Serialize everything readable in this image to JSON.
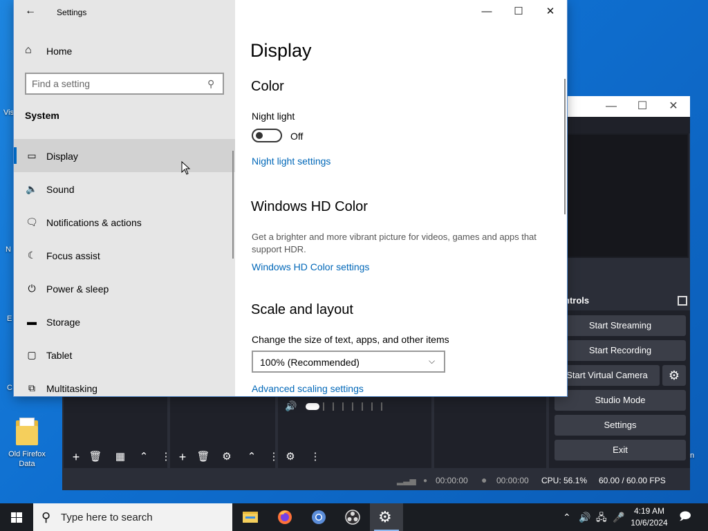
{
  "desktop": {
    "icon_label": "Old Firefox Data",
    "edge_fragments": [
      "Vis",
      "N",
      "E",
      "C"
    ],
    "right_fragment": "n"
  },
  "settings": {
    "title": "Settings",
    "home": "Home",
    "search_placeholder": "Find a setting",
    "section": "System",
    "nav": [
      {
        "label": "Display",
        "icon": "monitor-icon"
      },
      {
        "label": "Sound",
        "icon": "speaker-icon"
      },
      {
        "label": "Notifications & actions",
        "icon": "notification-icon"
      },
      {
        "label": "Focus assist",
        "icon": "moon-icon"
      },
      {
        "label": "Power & sleep",
        "icon": "power-icon"
      },
      {
        "label": "Storage",
        "icon": "storage-icon"
      },
      {
        "label": "Tablet",
        "icon": "tablet-icon"
      },
      {
        "label": "Multitasking",
        "icon": "multitasking-icon"
      }
    ],
    "main": {
      "title": "Display",
      "color_hdr": "Color",
      "night_light_label": "Night light",
      "night_light_state": "Off",
      "night_light_link": "Night light settings",
      "hdr_hdr": "Windows HD Color",
      "hdr_desc": "Get a brighter and more vibrant picture for videos, games and apps that support HDR.",
      "hdr_link": "Windows HD Color settings",
      "scale_hdr": "Scale and layout",
      "scale_label": "Change the size of text, apps, and other items",
      "scale_value": "100% (Recommended)",
      "advanced_link": "Advanced scaling settings"
    }
  },
  "obs": {
    "controls_title": "ntrols",
    "buttons": [
      "Start Streaming",
      "Start Recording",
      "Start Virtual Camera",
      "Studio Mode",
      "Settings",
      "Exit"
    ],
    "status": {
      "stream_time": "00:00:00",
      "rec_time": "00:00:00",
      "cpu": "CPU: 56.1%",
      "fps": "60.00 / 60.00 FPS"
    }
  },
  "taskbar": {
    "search_placeholder": "Type here to search",
    "time": "4:19 AM",
    "date": "10/6/2024"
  }
}
